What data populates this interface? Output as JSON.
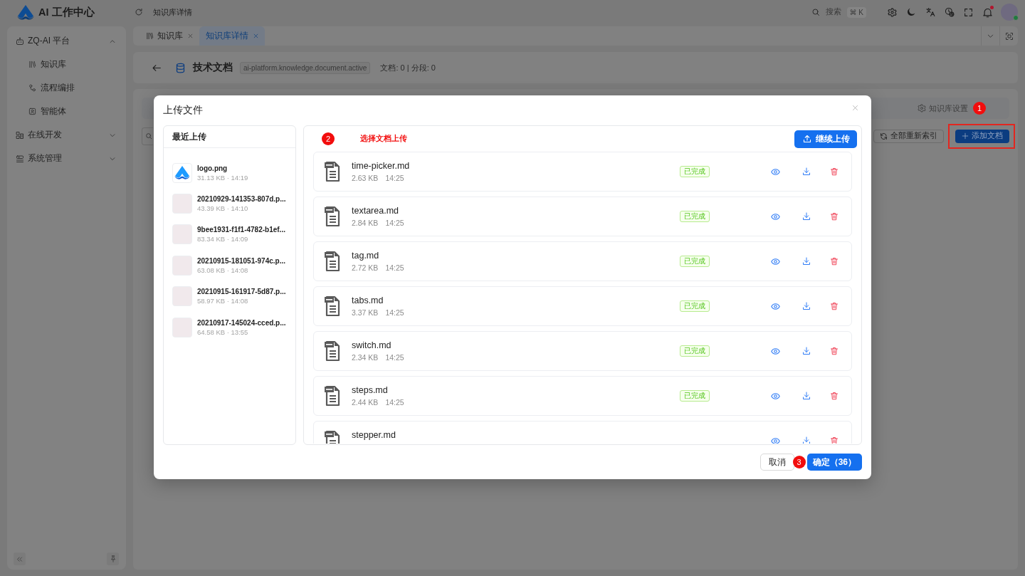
{
  "header": {
    "app_name": "AI 工作中心",
    "breadcrumb": "知识库详情",
    "search": {
      "label": "搜索",
      "shortcut": "⌘ K"
    },
    "notifications": {
      "unread": true
    },
    "user": {
      "online": true
    }
  },
  "sidebar": {
    "items": [
      {
        "label": "ZQ-AI 平台",
        "expanded": true,
        "children": [
          {
            "label": "知识库"
          },
          {
            "label": "流程编排"
          },
          {
            "label": "智能体"
          }
        ]
      },
      {
        "label": "在线开发",
        "expanded": false
      },
      {
        "label": "系统管理",
        "expanded": false
      }
    ]
  },
  "tabs": [
    {
      "label": "知识库",
      "kind": "iconic",
      "selected": false
    },
    {
      "label": "知识库详情",
      "kind": "plain",
      "selected": true
    }
  ],
  "page_header": {
    "title": "技术文档",
    "tag": "ai-platform.knowledge.document.active",
    "stats": "文档: 0 | 分段: 0"
  },
  "toolbar": {
    "settings": "知识库设置",
    "callout": "1",
    "reindex": "全部重新索引",
    "add": {
      "label": "添加文档",
      "highlighted": true
    }
  },
  "dialog": {
    "title": "上传文件",
    "recent": {
      "title": "最近上传",
      "items": [
        {
          "kind": "logo",
          "name": "logo.png",
          "meta": "31.13 KB · 14:19"
        },
        {
          "kind": "image",
          "name": "20210929-141353-807d.p...",
          "meta": "43.39 KB · 14:10"
        },
        {
          "kind": "image",
          "name": "9bee1931-f1f1-4782-b1ef...",
          "meta": "83.34 KB · 14:09"
        },
        {
          "kind": "image",
          "name": "20210915-181051-974c.p...",
          "meta": "63.08 KB · 14:08"
        },
        {
          "kind": "image",
          "name": "20210915-161917-5d87.p...",
          "meta": "58.97 KB · 14:08"
        },
        {
          "kind": "image",
          "name": "20210917-145024-cced.p...",
          "meta": "64.58 KB · 13:55"
        }
      ]
    },
    "upload": {
      "callout": "2",
      "hint": "选择文档上传",
      "button": "继续上传",
      "files": [
        {
          "name": "time-picker.md",
          "size": "2.63 KB",
          "time": "14:25",
          "status": "已完成"
        },
        {
          "name": "textarea.md",
          "size": "2.84 KB",
          "time": "14:25",
          "status": "已完成"
        },
        {
          "name": "tag.md",
          "size": "2.72 KB",
          "time": "14:25",
          "status": "已完成"
        },
        {
          "name": "tabs.md",
          "size": "3.37 KB",
          "time": "14:25",
          "status": "已完成"
        },
        {
          "name": "switch.md",
          "size": "2.34 KB",
          "time": "14:25",
          "status": "已完成"
        },
        {
          "name": "steps.md",
          "size": "2.44 KB",
          "time": "14:25",
          "status": "已完成"
        },
        {
          "name": "stepper.md"
        }
      ]
    },
    "footer": {
      "cancel": "取消",
      "callout": "3",
      "confirm": "确定（36）"
    }
  }
}
